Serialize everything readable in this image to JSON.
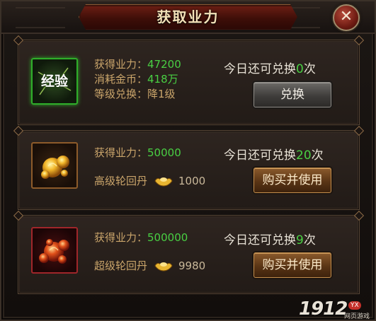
{
  "window": {
    "title": "获取业力",
    "close_symbol": "✕"
  },
  "rows": [
    {
      "icon": "exp-badge-icon",
      "icon_text": "经验",
      "lines": [
        {
          "label": "获得业力：",
          "value": "47200",
          "color": "green"
        },
        {
          "label": "消耗金币：",
          "value": "418万",
          "color": "green"
        },
        {
          "label": "等级兑换：",
          "value": "降1级",
          "color": "plain"
        }
      ],
      "limit_prefix": "今日还可兑换",
      "limit_count": "0",
      "limit_suffix": "次",
      "button_label": "兑换",
      "button_style": "grey"
    },
    {
      "icon": "gold-elixir-icon",
      "lines": [
        {
          "label": "获得业力：",
          "value": "50000",
          "color": "green"
        }
      ],
      "item_name": "高级轮回丹",
      "price": "1000",
      "limit_prefix": "今日还可兑换",
      "limit_count": "20",
      "limit_suffix": "次",
      "button_label": "购买并使用",
      "button_style": "bronze"
    },
    {
      "icon": "red-elixir-icon",
      "lines": [
        {
          "label": "获得业力：",
          "value": "500000",
          "color": "green"
        }
      ],
      "item_name": "超级轮回丹",
      "price": "9980",
      "limit_prefix": "今日还可兑换",
      "limit_count": "9",
      "limit_suffix": "次",
      "button_label": "购买并使用",
      "button_style": "bronze"
    }
  ],
  "watermark": {
    "number": "1912",
    "badge": "YX",
    "subtitle": "网页游戏"
  },
  "colors": {
    "highlight_green": "#49cf43",
    "label_gold": "#c9a46a",
    "title_text": "#f4e1b8"
  }
}
